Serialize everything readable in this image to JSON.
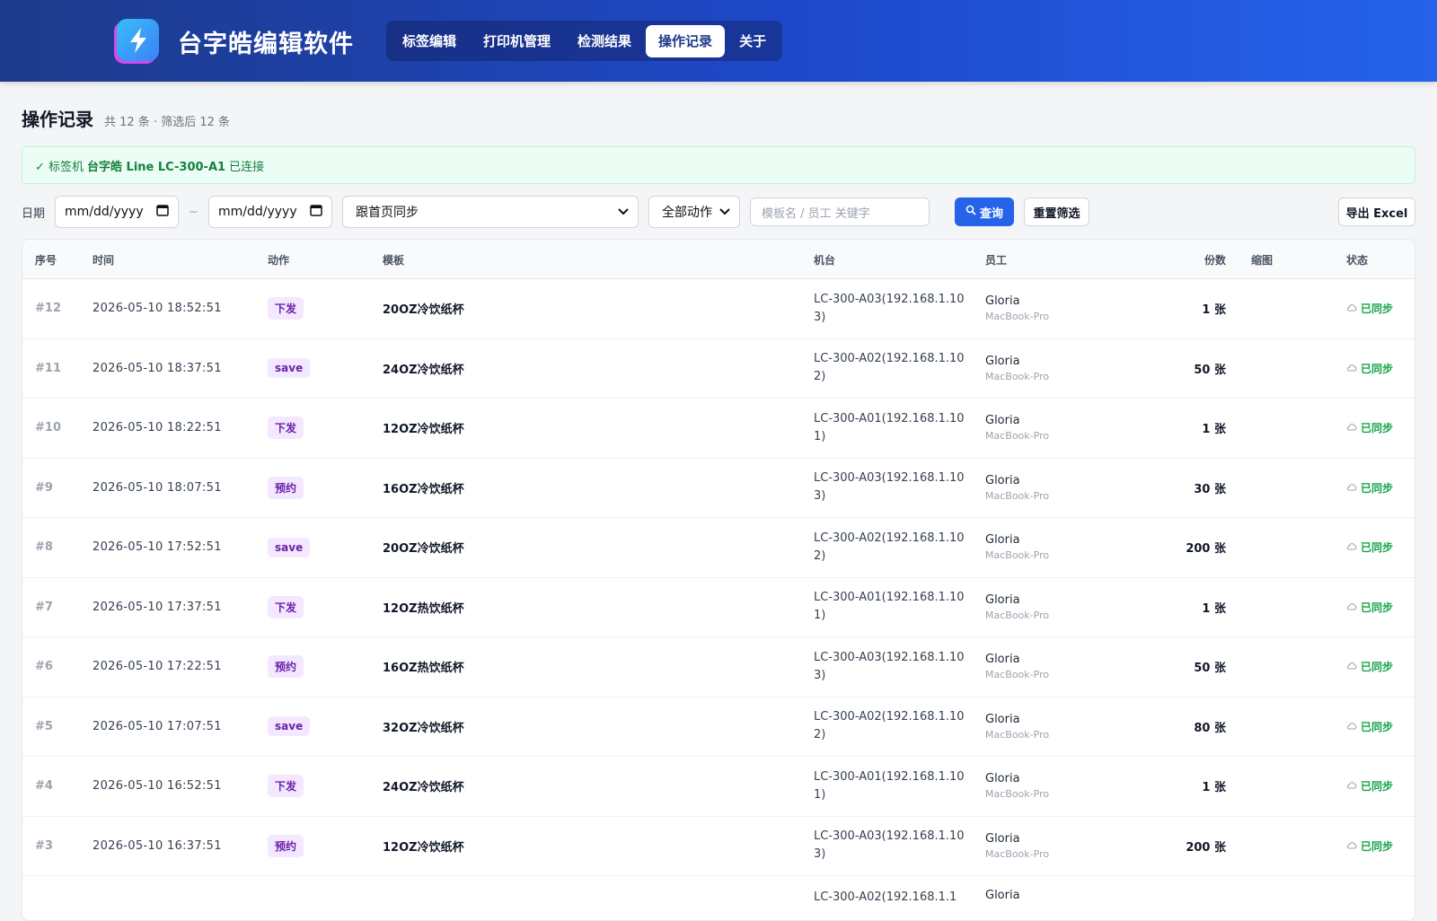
{
  "app": {
    "title": "台字皓编辑软件"
  },
  "nav": {
    "tabs": [
      "标签编辑",
      "打印机管理",
      "检测结果",
      "操作记录",
      "关于"
    ],
    "active_index": 3
  },
  "page": {
    "title": "操作记录",
    "count": "共 12 条 · 筛选后 12 条"
  },
  "banner": {
    "prefix": "✓ 标签机",
    "device": "台字皓 Line LC-300-A1",
    "suffix": "已连接"
  },
  "filters": {
    "date_label": "日期",
    "date_from": "mm/dd/yyyy",
    "tilde": "~",
    "date_to": "mm/dd/yyyy",
    "sync_select": "跟首页同步",
    "action_select": "全部动作",
    "search_placeholder": "模板名 / 员工 关键字",
    "query_button": "查询",
    "reset_button": "重置筛选",
    "export_button": "导出 Excel"
  },
  "table": {
    "columns": [
      "序号",
      "时间",
      "动作",
      "模板",
      "机台",
      "员工",
      "份数",
      "缩图",
      "状态"
    ],
    "rows": [
      {
        "id": "#12",
        "time": "2026-05-10 18:52:51",
        "action": "下发",
        "template": "20OZ冷饮纸杯",
        "machine": "LC-300-A03(192.168.1.103)",
        "employee": "Gloria",
        "device": "MacBook-Pro",
        "qty": "1 张",
        "status": "已同步"
      },
      {
        "id": "#11",
        "time": "2026-05-10 18:37:51",
        "action": "save",
        "template": "24OZ冷饮纸杯",
        "machine": "LC-300-A02(192.168.1.102)",
        "employee": "Gloria",
        "device": "MacBook-Pro",
        "qty": "50 张",
        "status": "已同步"
      },
      {
        "id": "#10",
        "time": "2026-05-10 18:22:51",
        "action": "下发",
        "template": "12OZ冷饮纸杯",
        "machine": "LC-300-A01(192.168.1.101)",
        "employee": "Gloria",
        "device": "MacBook-Pro",
        "qty": "1 张",
        "status": "已同步"
      },
      {
        "id": "#9",
        "time": "2026-05-10 18:07:51",
        "action": "预约",
        "template": "16OZ冷饮纸杯",
        "machine": "LC-300-A03(192.168.1.103)",
        "employee": "Gloria",
        "device": "MacBook-Pro",
        "qty": "30 张",
        "status": "已同步"
      },
      {
        "id": "#8",
        "time": "2026-05-10 17:52:51",
        "action": "save",
        "template": "20OZ冷饮纸杯",
        "machine": "LC-300-A02(192.168.1.102)",
        "employee": "Gloria",
        "device": "MacBook-Pro",
        "qty": "200 张",
        "status": "已同步"
      },
      {
        "id": "#7",
        "time": "2026-05-10 17:37:51",
        "action": "下发",
        "template": "12OZ热饮纸杯",
        "machine": "LC-300-A01(192.168.1.101)",
        "employee": "Gloria",
        "device": "MacBook-Pro",
        "qty": "1 张",
        "status": "已同步"
      },
      {
        "id": "#6",
        "time": "2026-05-10 17:22:51",
        "action": "预约",
        "template": "16OZ热饮纸杯",
        "machine": "LC-300-A03(192.168.1.103)",
        "employee": "Gloria",
        "device": "MacBook-Pro",
        "qty": "50 张",
        "status": "已同步"
      },
      {
        "id": "#5",
        "time": "2026-05-10 17:07:51",
        "action": "save",
        "template": "32OZ冷饮纸杯",
        "machine": "LC-300-A02(192.168.1.102)",
        "employee": "Gloria",
        "device": "MacBook-Pro",
        "qty": "80 张",
        "status": "已同步"
      },
      {
        "id": "#4",
        "time": "2026-05-10 16:52:51",
        "action": "下发",
        "template": "24OZ冷饮纸杯",
        "machine": "LC-300-A01(192.168.1.101)",
        "employee": "Gloria",
        "device": "MacBook-Pro",
        "qty": "1 张",
        "status": "已同步"
      },
      {
        "id": "#3",
        "time": "2026-05-10 16:37:51",
        "action": "预约",
        "template": "12OZ冷饮纸杯",
        "machine": "LC-300-A03(192.168.1.103)",
        "employee": "Gloria",
        "device": "MacBook-Pro",
        "qty": "200 张",
        "status": "已同步"
      },
      {
        "id": "",
        "time": "",
        "action": "",
        "template": "",
        "machine": "LC-300-A02(192.168.1.1",
        "employee": "Gloria",
        "device": "",
        "qty": "",
        "status": ""
      }
    ]
  },
  "colors": {
    "header_start": "#1e3a8a",
    "header_end": "#2563eb",
    "accent": "#2563eb",
    "success": "#16a34a",
    "badge_bg": "#f3e8ff",
    "badge_text": "#6b21a8"
  }
}
